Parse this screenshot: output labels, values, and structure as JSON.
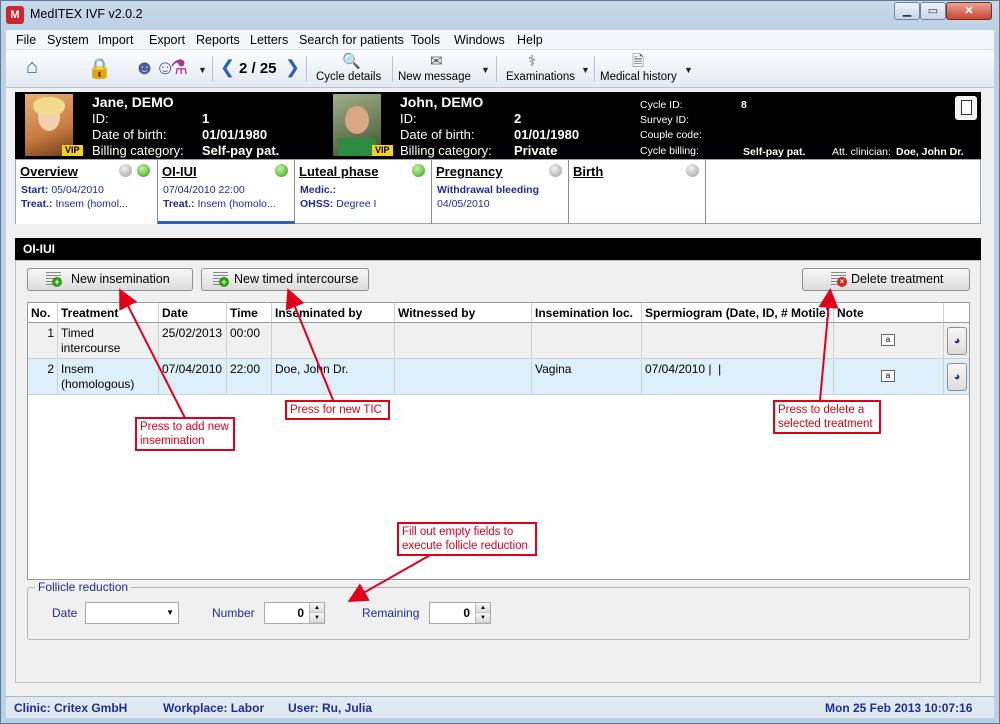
{
  "window": {
    "title": "MedITEX IVF v2.0.2",
    "logo_text": "M"
  },
  "menu": [
    "File",
    "System",
    "Import",
    "Export",
    "Reports",
    "Letters",
    "Search for patients",
    "Tools",
    "Windows",
    "Help"
  ],
  "toolbar": {
    "pager": "2 / 25",
    "cycle_details": "Cycle details",
    "new_message": "New message",
    "examinations": "Examinations",
    "medical_history": "Medical history"
  },
  "patient_female": {
    "name": "Jane, DEMO",
    "id_label": "ID:",
    "id": "1",
    "dob_label": "Date of birth:",
    "dob": "01/01/1980",
    "billing_label": "Billing category:",
    "billing": "Self-pay pat.",
    "vip": "VIP"
  },
  "patient_male": {
    "name": "John, DEMO",
    "id_label": "ID:",
    "id": "2",
    "dob_label": "Date of birth:",
    "dob": "01/01/1980",
    "billing_label": "Billing category:",
    "billing": "Private",
    "vip": "VIP"
  },
  "cycle": {
    "cycle_id_label": "Cycle ID:",
    "cycle_id": "8",
    "survey_id_label": "Survey ID:",
    "couple_code_label": "Couple code:",
    "cycle_billing_label": "Cycle billing:",
    "cycle_billing": "Self-pay pat.",
    "clinician_label": "Att. clinician:",
    "clinician": "Doe, John Dr."
  },
  "phases": [
    {
      "title": "Overview",
      "line1_label": "Start:",
      "line1": "05/04/2010",
      "line2_label": "Treat.:",
      "line2": "Insem (homol..."
    },
    {
      "title": "OI-IUI",
      "line1_label": "",
      "line1": "07/04/2010 22:00",
      "line2_label": "Treat.:",
      "line2": "Insem (homolo..."
    },
    {
      "title": "Luteal phase",
      "line1_label": "Medic.:",
      "line1": "",
      "line2_label": "OHSS:",
      "line2": "Degree I"
    },
    {
      "title": "Pregnancy",
      "line1_label": "Withdrawal bleeding",
      "line1": "",
      "line2_label": "",
      "line2": "04/05/2010"
    },
    {
      "title": "Birth",
      "line1_label": "",
      "line1": "",
      "line2_label": "",
      "line2": ""
    }
  ],
  "section": {
    "title": "OI-IUI",
    "new_insemination": "New insemination",
    "new_timed_intercourse": "New timed intercourse",
    "delete_treatment": "Delete treatment"
  },
  "table": {
    "columns": [
      "No.",
      "Treatment",
      "Date",
      "Time",
      "Inseminated by",
      "Witnessed by",
      "Insemination loc.",
      "Spermiogram (Date, ID, # Motile)",
      "Note"
    ],
    "rows": [
      {
        "no": "1",
        "treatment_1": "Timed",
        "treatment_2": "intercourse",
        "date": "25/02/2013",
        "time": "00:00",
        "inseminated_by": "",
        "witnessed_by": "",
        "location": "",
        "spermiogram": ""
      },
      {
        "no": "2",
        "treatment_1": "Insem",
        "treatment_2": "(homologous)",
        "date": "07/04/2010",
        "time": "22:00",
        "inseminated_by": "Doe, John Dr.",
        "witnessed_by": "",
        "location": "Vagina",
        "spermiogram": "07/04/2010 |  |"
      }
    ]
  },
  "follicle": {
    "legend": "Follicle reduction",
    "date_label": "Date",
    "date_value": "",
    "number_label": "Number",
    "number_value": "0",
    "remaining_label": "Remaining",
    "remaining_value": "0"
  },
  "annotations": {
    "add_insemination_1": "Press to add new",
    "add_insemination_2": "insemination",
    "new_tic": "Press for new TIC",
    "delete_1": "Press to delete a",
    "delete_2": "selected treatment",
    "follicle_1": "Fill out empty fields to",
    "follicle_2": "execute follicle reduction"
  },
  "status": {
    "clinic": "Clinic: Critex GmbH",
    "workplace": "Workplace: Labor",
    "user": "User: Ru, Julia",
    "datetime": "Mon 25 Feb 2013 10:07:16"
  },
  "colors": {
    "accent_blue": "#1e2c9c",
    "annotation_red": "#e1001b",
    "header_black": "#000000"
  }
}
